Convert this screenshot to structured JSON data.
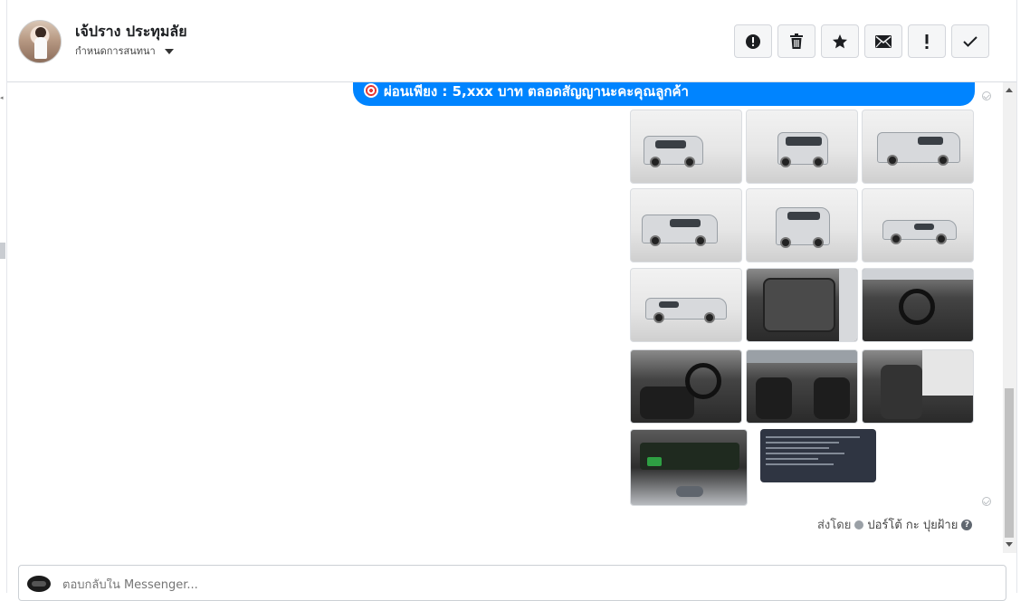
{
  "header": {
    "contact_name": "เจ้ปราง ประทุมลัย",
    "assign_label": "กำหนดการสนทนา",
    "toolbar": [
      {
        "name": "spam-icon",
        "glyph": "!"
      },
      {
        "name": "trash-icon",
        "glyph": ""
      },
      {
        "name": "star-icon",
        "glyph": "★"
      },
      {
        "name": "mail-icon",
        "glyph": ""
      },
      {
        "name": "exclamation-icon",
        "glyph": "!"
      },
      {
        "name": "check-icon",
        "glyph": "✓"
      }
    ]
  },
  "message": {
    "text": "ผ่อนเพียง : 5,xxx บาท ตลอดสัญญานะคะคุณลูกค้า",
    "color": "#0084ff",
    "photos": [
      "truck-front-three-quarter",
      "truck-front",
      "truck-rear-three-quarter",
      "truck-front-side",
      "truck-rear",
      "truck-side-studio",
      "truck-side",
      "door-interior",
      "dashboard-interior",
      "gear-shifter-interior",
      "front-seats-interior",
      "rear-seats-interior",
      "engine-bay",
      "vehicle-document"
    ]
  },
  "footer": {
    "sent_by_label": "ส่งโดย",
    "sender_name": "ปอร์โต้ กะ ปุยฝ้าย"
  },
  "composer": {
    "placeholder": "ตอบกลับใน Messenger..."
  }
}
